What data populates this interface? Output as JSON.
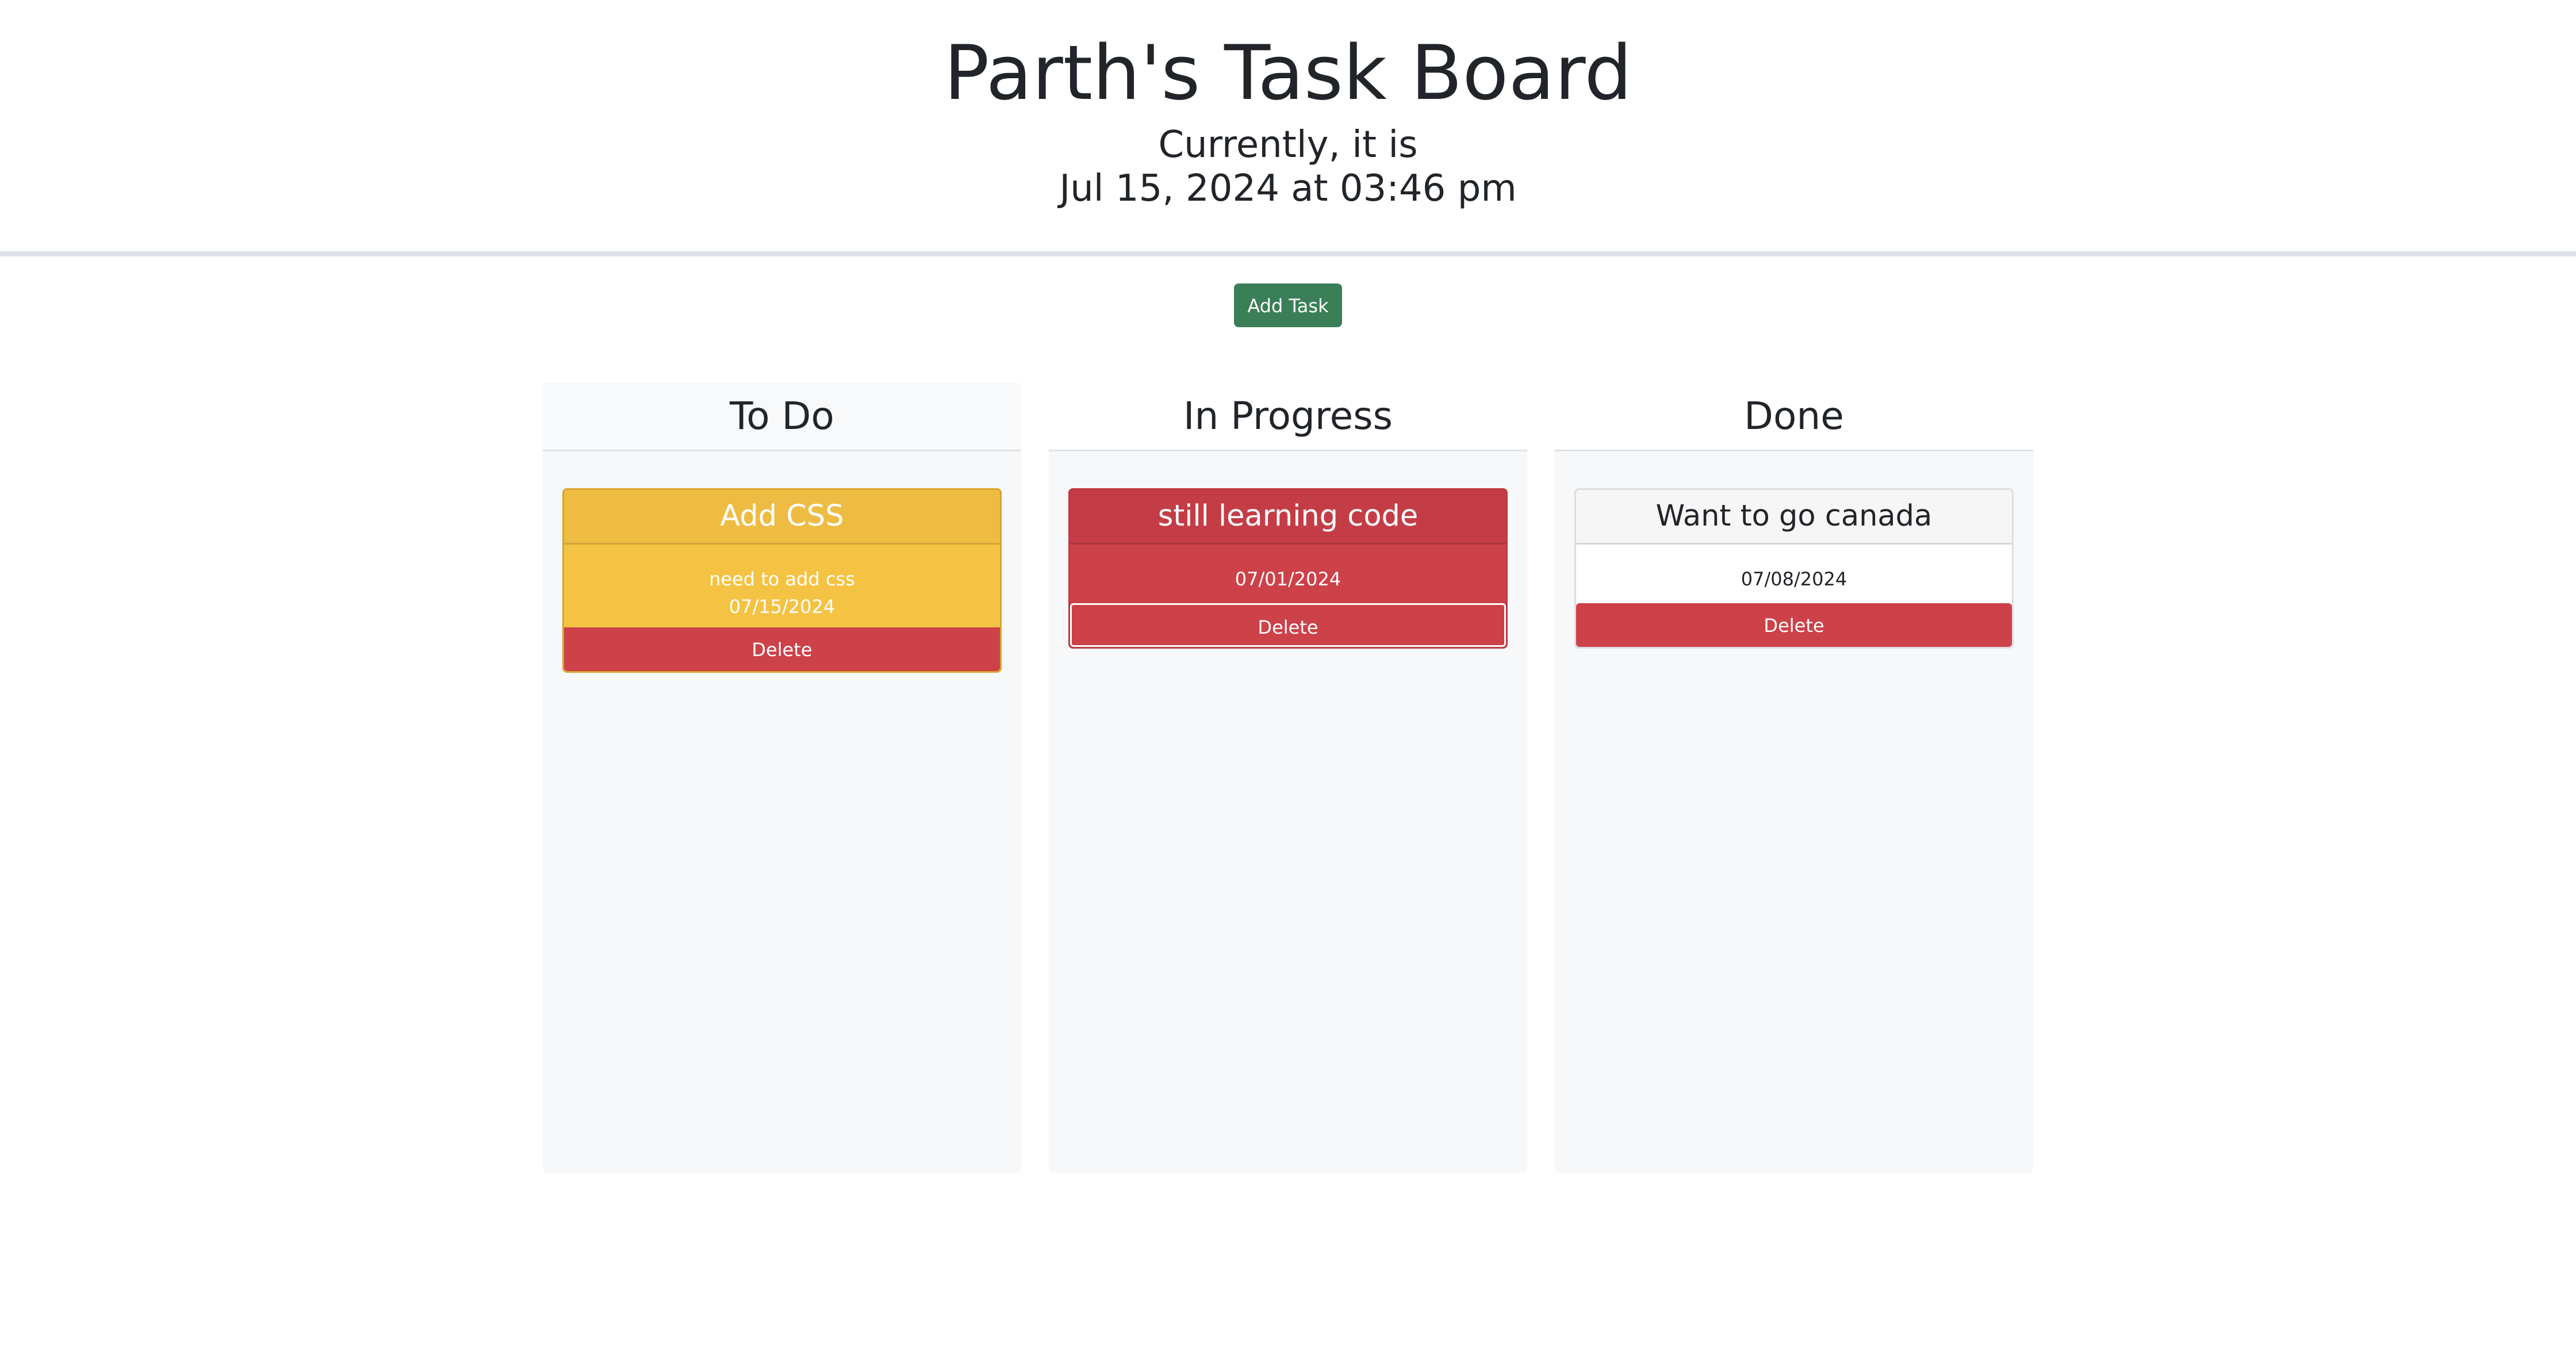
{
  "header": {
    "title": "Parth's Task Board",
    "subtitle_line1": "Currently, it is",
    "subtitle_line2": "Jul 15, 2024 at 03:46 pm"
  },
  "toolbar": {
    "add_task_label": "Add Task",
    "add_task_color": "#3a7f57"
  },
  "lanes": [
    {
      "title": "To Do",
      "cards": [
        {
          "title": "Add CSS",
          "description": "need to add css",
          "date": "07/15/2024",
          "status": "warning",
          "color": "#f5c344",
          "delete_label": "Delete"
        }
      ]
    },
    {
      "title": "In Progress",
      "cards": [
        {
          "title": "still learning code",
          "date": "07/01/2024",
          "status": "danger",
          "color": "#cd4149",
          "delete_label": "Delete"
        }
      ]
    },
    {
      "title": "Done",
      "cards": [
        {
          "title": "Want to go canada",
          "date": "07/08/2024",
          "status": "plain",
          "color": "#ffffff",
          "delete_label": "Delete"
        }
      ]
    }
  ]
}
